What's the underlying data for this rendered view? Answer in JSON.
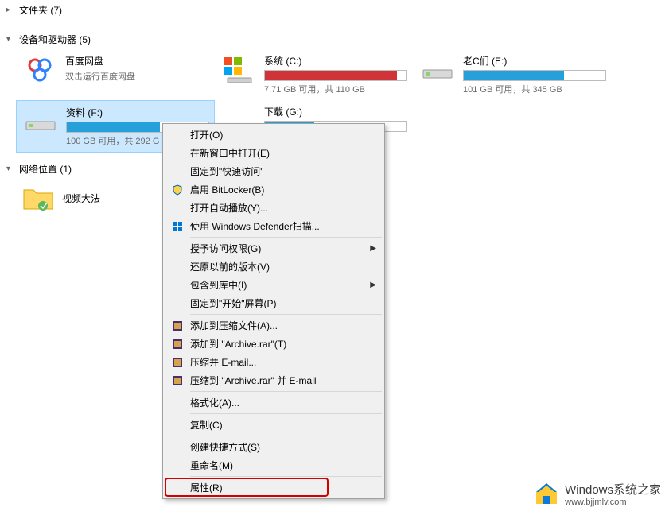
{
  "sections": {
    "folders": {
      "label": "文件夹 (7)",
      "expanded": false
    },
    "devices": {
      "label": "设备和驱动器 (5)",
      "expanded": true
    },
    "network": {
      "label": "网络位置 (1)",
      "expanded": true
    }
  },
  "drives": {
    "baidu": {
      "name": "百度网盘",
      "subtitle": "双击运行百度网盘"
    },
    "system": {
      "name": "系统 (C:)",
      "status": "7.71 GB 可用，共 110 GB",
      "fill": 93,
      "color": "red"
    },
    "old_c": {
      "name": "老C们 (E:)",
      "status": "101 GB 可用，共 345 GB",
      "fill": 71,
      "color": "blue"
    },
    "data": {
      "name": "资料 (F:)",
      "status": "100 GB 可用，共 292 G",
      "fill": 66,
      "color": "blue",
      "selected": true
    },
    "download": {
      "name": "下载 (G:)",
      "fill": 35,
      "color": "blue"
    }
  },
  "network_items": {
    "video": {
      "name": "视频大法"
    }
  },
  "menu": {
    "open": "打开(O)",
    "open_new": "在新窗口中打开(E)",
    "pin_quick": "固定到\"快速访问\"",
    "bitlocker": "启用 BitLocker(B)",
    "autoplay": "打开自动播放(Y)...",
    "defender": "使用 Windows Defender扫描...",
    "grant_access": "授予访问权限(G)",
    "restore": "还原以前的版本(V)",
    "library": "包含到库中(I)",
    "pin_start": "固定到\"开始\"屏幕(P)",
    "add_archive": "添加到压缩文件(A)...",
    "add_to_rar": "添加到 \"Archive.rar\"(T)",
    "compress_email": "压缩并 E-mail...",
    "compress_rar_email": "压缩到 \"Archive.rar\" 并 E-mail",
    "format": "格式化(A)...",
    "copy": "复制(C)",
    "shortcut": "创建快捷方式(S)",
    "rename": "重命名(M)",
    "properties": "属性(R)"
  },
  "watermark": {
    "title": "Windows系统之家",
    "url": "www.bjjmlv.com"
  }
}
